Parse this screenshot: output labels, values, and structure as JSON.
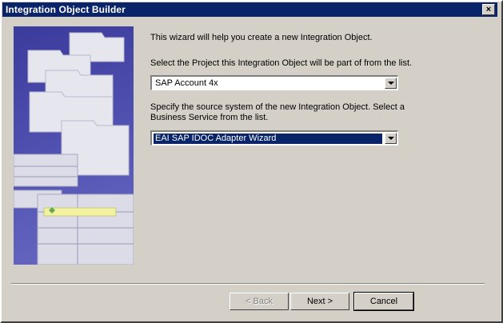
{
  "window": {
    "title": "Integration Object Builder"
  },
  "intro": "This wizard will help you create a new Integration Object.",
  "project": {
    "label": "Select the Project this Integration Object will be part of from the list.",
    "selected": "SAP Account 4x"
  },
  "source": {
    "label_line1": "Specify the source system of the new Integration Object. Select a",
    "label_line2": "Business Service from the list.",
    "selected": "EAI SAP IDOC Adapter Wizard"
  },
  "buttons": {
    "back": "< Back",
    "next": "Next >",
    "cancel": "Cancel"
  },
  "icons": {
    "close": "close-icon",
    "dropdown": "chevron-down-icon",
    "artwork": "wizard-artwork"
  }
}
